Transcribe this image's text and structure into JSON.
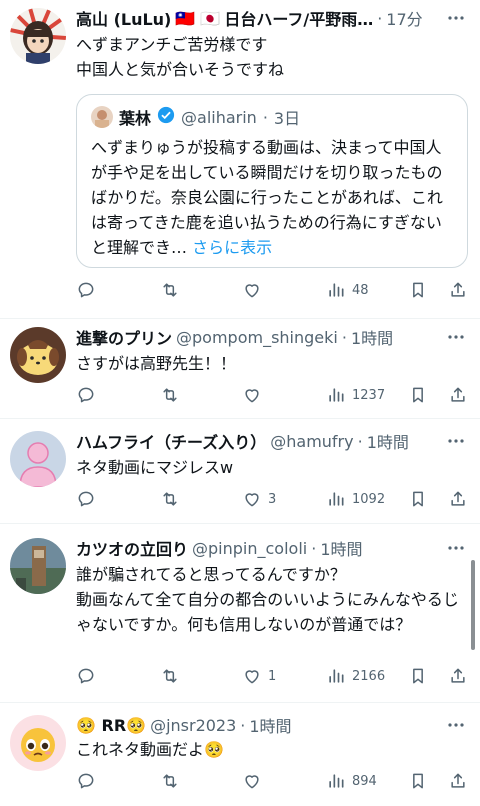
{
  "tweets": [
    {
      "name": "高山 (LuLu)",
      "flags": "🇹🇼 🇯🇵",
      "name_suffix": "日台ハーフ/平野雨…",
      "handle": "",
      "time": "17分",
      "text": "へずまアンチご苦労様です\n中国人と気が合いそうですね",
      "quote": {
        "name": "葉林",
        "handle": "@aliharin",
        "time": "3日",
        "text": "へずまりゅうが投稿する動画は、決まって中国人が手や足を出している瞬間だけを切り取ったものばかりだ。奈良公園に行ったことがあれば、これは寄ってきた鹿を追い払うための行為にすぎないと理解でき… ",
        "show_more": "さらに表示"
      },
      "actions": {
        "reply": "",
        "retweet": "",
        "like": "",
        "views": "48"
      }
    },
    {
      "name": "進撃のプリン",
      "handle": "@pompom_shingeki",
      "time": "1時間",
      "text": "さすがは高野先生！！",
      "actions": {
        "reply": "",
        "retweet": "",
        "like": "",
        "views": "1237"
      }
    },
    {
      "name": "ハムフライ（チーズ入り）",
      "handle": "@hamufry",
      "time": "1時間",
      "text": "ネタ動画にマジレスw",
      "actions": {
        "reply": "",
        "retweet": "",
        "like": "3",
        "views": "1092"
      }
    },
    {
      "name": "カツオの立回り",
      "handle": "@pinpin_cololi",
      "time": "1時間",
      "text": "誰が騙されてると思ってるんですか？\n動画なんて全て自分の都合のいいようにみんなやるじゃないですか。何も信用しないのが普通では？",
      "actions": {
        "reply": "",
        "retweet": "",
        "like": "1",
        "views": "2166"
      }
    },
    {
      "name": "🥺 RR🥺",
      "handle": "@jnsr2023",
      "time": "1時間",
      "text": "これネタ動画だよ🥺",
      "actions": {
        "reply": "",
        "retweet": "",
        "like": "",
        "views": "894"
      }
    }
  ],
  "separator": "·",
  "colors": {
    "text": "#0f1419",
    "secondary": "#536471",
    "link": "#1d9bf0",
    "border": "#eff3f4"
  },
  "icons": [
    "reply-icon",
    "retweet-icon",
    "like-icon",
    "views-icon",
    "bookmark-icon",
    "share-icon",
    "more-icon",
    "verified-icon"
  ]
}
